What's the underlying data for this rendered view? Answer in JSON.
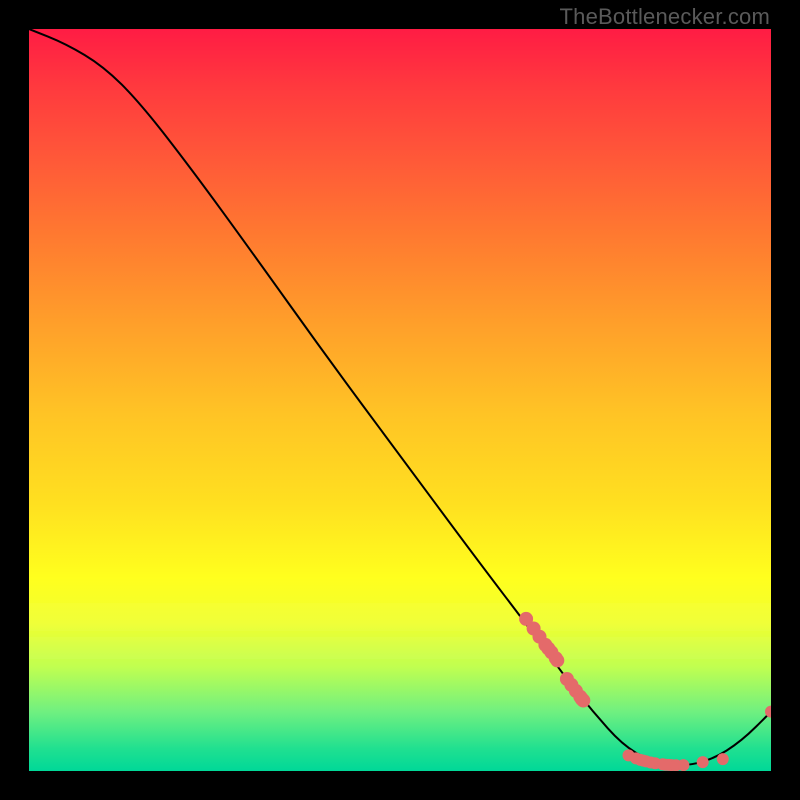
{
  "watermark": "TheBottlenecker.com",
  "chart_data": {
    "type": "line",
    "title": "",
    "xlabel": "",
    "ylabel": "",
    "xlim": [
      0,
      100
    ],
    "ylim": [
      0,
      100
    ],
    "background_gradient": {
      "top": "#ff1c44",
      "mid_upper": "#ff9a2c",
      "mid": "#ffe820",
      "mid_lower": "#c8ff40",
      "bottom": "#00d898"
    },
    "curve": [
      {
        "x": 0,
        "y": 100
      },
      {
        "x": 5,
        "y": 98
      },
      {
        "x": 10,
        "y": 95
      },
      {
        "x": 15,
        "y": 90
      },
      {
        "x": 22,
        "y": 81
      },
      {
        "x": 30,
        "y": 70
      },
      {
        "x": 40,
        "y": 56
      },
      {
        "x": 50,
        "y": 42.5
      },
      {
        "x": 60,
        "y": 29
      },
      {
        "x": 68,
        "y": 18.5
      },
      {
        "x": 72,
        "y": 13
      },
      {
        "x": 76,
        "y": 8
      },
      {
        "x": 80,
        "y": 3.5
      },
      {
        "x": 84,
        "y": 1.2
      },
      {
        "x": 88,
        "y": 0.6
      },
      {
        "x": 92,
        "y": 1.5
      },
      {
        "x": 96,
        "y": 4
      },
      {
        "x": 100,
        "y": 8
      }
    ],
    "points_cluster_upper": [
      {
        "x": 67,
        "y": 20.5
      },
      {
        "x": 68,
        "y": 19.2
      },
      {
        "x": 68.8,
        "y": 18.1
      },
      {
        "x": 69.6,
        "y": 17.0
      },
      {
        "x": 70,
        "y": 16.5
      },
      {
        "x": 70.4,
        "y": 16.0
      },
      {
        "x": 71,
        "y": 15.2
      },
      {
        "x": 71.2,
        "y": 14.9
      }
    ],
    "points_cluster_mid": [
      {
        "x": 72.5,
        "y": 12.4
      },
      {
        "x": 73.1,
        "y": 11.6
      },
      {
        "x": 73.7,
        "y": 10.8
      },
      {
        "x": 74.3,
        "y": 10.0
      },
      {
        "x": 74.5,
        "y": 9.7
      },
      {
        "x": 74.7,
        "y": 9.5
      }
    ],
    "points_valley_floor": [
      {
        "x": 80.8,
        "y": 2.1
      },
      {
        "x": 81.8,
        "y": 1.7
      },
      {
        "x": 82.4,
        "y": 1.5
      },
      {
        "x": 82.8,
        "y": 1.4
      },
      {
        "x": 83.2,
        "y": 1.3
      },
      {
        "x": 83.8,
        "y": 1.15
      },
      {
        "x": 84.4,
        "y": 1.05
      },
      {
        "x": 85.4,
        "y": 0.9
      },
      {
        "x": 85.8,
        "y": 0.85
      },
      {
        "x": 86.2,
        "y": 0.82
      },
      {
        "x": 86.6,
        "y": 0.8
      },
      {
        "x": 87.2,
        "y": 0.78
      },
      {
        "x": 88.2,
        "y": 0.8
      },
      {
        "x": 90.8,
        "y": 1.2
      },
      {
        "x": 93.5,
        "y": 1.6
      }
    ],
    "point_end": {
      "x": 100,
      "y": 8
    }
  }
}
